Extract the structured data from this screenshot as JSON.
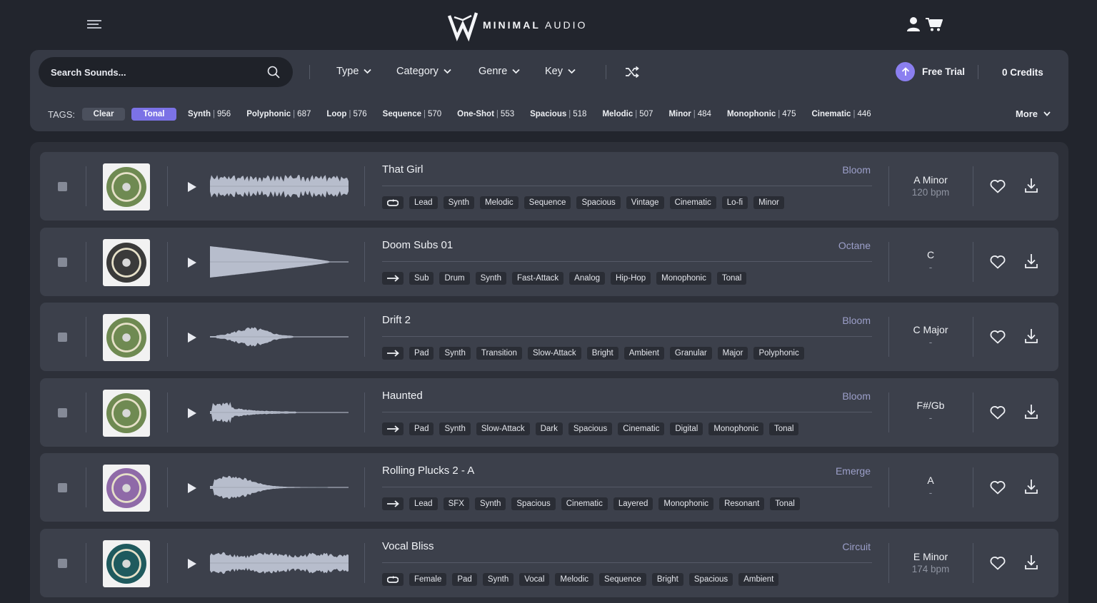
{
  "brand": {
    "name_bold": "MINIMAL",
    "name_light": "AUDIO"
  },
  "search": {
    "placeholder": "Search Sounds..."
  },
  "filters": [
    {
      "label": "Type"
    },
    {
      "label": "Category"
    },
    {
      "label": "Genre"
    },
    {
      "label": "Key"
    }
  ],
  "account": {
    "free_trial": "Free Trial",
    "credits": "0 Credits"
  },
  "tags": {
    "label": "TAGS:",
    "clear": "Clear",
    "active": "Tonal",
    "items": [
      {
        "name": "Synth",
        "count": "956"
      },
      {
        "name": "Polyphonic",
        "count": "687"
      },
      {
        "name": "Loop",
        "count": "576"
      },
      {
        "name": "Sequence",
        "count": "570"
      },
      {
        "name": "One-Shot",
        "count": "553"
      },
      {
        "name": "Spacious",
        "count": "518"
      },
      {
        "name": "Melodic",
        "count": "507"
      },
      {
        "name": "Minor",
        "count": "484"
      },
      {
        "name": "Monophonic",
        "count": "475"
      },
      {
        "name": "Cinematic",
        "count": "446"
      }
    ],
    "more": "More"
  },
  "sounds": [
    {
      "name": "That Girl",
      "pack": "Bloom",
      "type_icon": "loop-icon",
      "key": "A Minor",
      "bpm": "120 bpm",
      "tags": [
        "Lead",
        "Synth",
        "Melodic",
        "Sequence",
        "Spacious",
        "Vintage",
        "Cinematic",
        "Lo-fi",
        "Minor"
      ],
      "thumb_color": "#6f8a52"
    },
    {
      "name": "Doom Subs 01",
      "pack": "Octane",
      "type_icon": "one-shot-icon",
      "key": "C",
      "bpm": "-",
      "tags": [
        "Sub",
        "Drum",
        "Synth",
        "Fast-Attack",
        "Analog",
        "Hip-Hop",
        "Monophonic",
        "Tonal"
      ],
      "thumb_color": "#3a3a3a"
    },
    {
      "name": "Drift 2",
      "pack": "Bloom",
      "type_icon": "one-shot-icon",
      "key": "C Major",
      "bpm": "-",
      "tags": [
        "Pad",
        "Synth",
        "Transition",
        "Slow-Attack",
        "Bright",
        "Ambient",
        "Granular",
        "Major",
        "Polyphonic"
      ],
      "thumb_color": "#6f8a52"
    },
    {
      "name": "Haunted",
      "pack": "Bloom",
      "type_icon": "one-shot-icon",
      "key": "F#/Gb",
      "bpm": "-",
      "tags": [
        "Pad",
        "Synth",
        "Slow-Attack",
        "Dark",
        "Spacious",
        "Cinematic",
        "Digital",
        "Monophonic",
        "Tonal"
      ],
      "thumb_color": "#6f8a52"
    },
    {
      "name": "Rolling Plucks 2 - A",
      "pack": "Emerge",
      "type_icon": "one-shot-icon",
      "key": "A",
      "bpm": "-",
      "tags": [
        "Lead",
        "SFX",
        "Synth",
        "Spacious",
        "Cinematic",
        "Layered",
        "Monophonic",
        "Resonant",
        "Tonal"
      ],
      "thumb_color": "#8f6aa8"
    },
    {
      "name": "Vocal Bliss",
      "pack": "Circuit",
      "type_icon": "loop-icon",
      "key": "E Minor",
      "bpm": "174 bpm",
      "tags": [
        "Female",
        "Pad",
        "Synth",
        "Vocal",
        "Melodic",
        "Sequence",
        "Bright",
        "Spacious",
        "Ambient"
      ],
      "thumb_color": "#1f5a5e"
    }
  ]
}
